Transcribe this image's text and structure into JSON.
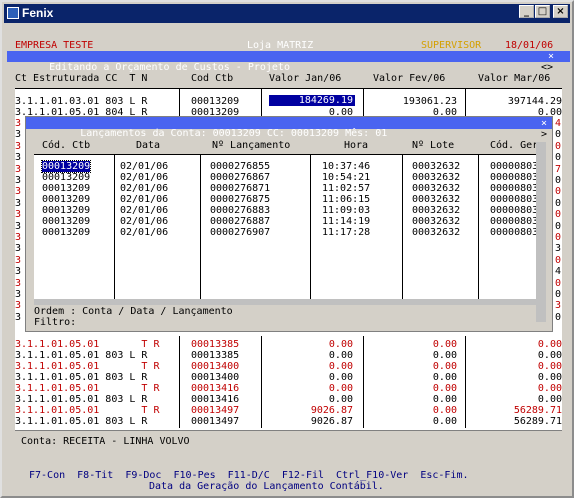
{
  "window": {
    "title": "Fenix"
  },
  "header": {
    "company": "EMPRESA TESTE",
    "store": "Loja MATRIZ",
    "role": "SUPERVISOR",
    "date": "18/01/06",
    "screen_title": " Editando a Orçamento de Custos - Projeto",
    "close_glyph": "×",
    "scroll_glyph": "<>"
  },
  "main": {
    "headers": {
      "ct": "Ct Estruturada CC  T N",
      "cod": "Cod Ctb",
      "jan": "Valor Jan/06",
      "fev": "Valor Fev/06",
      "mar": "Valor Mar/06"
    },
    "top_rows": [
      {
        "ct": "3.1.1.01.03.01 803 L R",
        "cod": "00013209",
        "jan": "184269.19",
        "fev": "193061.23",
        "mar": "397144.29"
      },
      {
        "ct": "3.1.1.01.05.01 804 L R",
        "cod": "00013209",
        "jan": "0.00",
        "fev": "0.00",
        "mar": "0.00"
      }
    ],
    "left_stub": [
      "3",
      "3",
      "3",
      "3",
      "3",
      "3",
      "3",
      "3",
      "3",
      "3",
      "3",
      "3",
      "3",
      "3",
      "3",
      "3",
      "3",
      "3"
    ],
    "right_stub": [
      "4",
      "0",
      "0",
      "0",
      "7",
      "0",
      "0",
      "0",
      "0",
      "0",
      "0",
      "3",
      "0",
      "4",
      "0",
      "0",
      "3",
      "0"
    ],
    "bottom_rows": [
      {
        "ct": "3.1.1.01.05.01       T R",
        "cod": "00013385",
        "jan": "0.00",
        "fev": "0.00",
        "mar": "0.00",
        "red": true
      },
      {
        "ct": "3.1.1.01.05.01 803 L R",
        "cod": "00013385",
        "jan": "0.00",
        "fev": "0.00",
        "mar": "0.00",
        "red": false
      },
      {
        "ct": "3.1.1.01.05.01       T R",
        "cod": "00013400",
        "jan": "0.00",
        "fev": "0.00",
        "mar": "0.00",
        "red": true
      },
      {
        "ct": "3.1.1.01.05.01 803 L R",
        "cod": "00013400",
        "jan": "0.00",
        "fev": "0.00",
        "mar": "0.00",
        "red": false
      },
      {
        "ct": "3.1.1.01.05.01       T R",
        "cod": "00013416",
        "jan": "0.00",
        "fev": "0.00",
        "mar": "0.00",
        "red": true
      },
      {
        "ct": "3.1.1.01.05.01 803 L R",
        "cod": "00013416",
        "jan": "0.00",
        "fev": "0.00",
        "mar": "0.00",
        "red": false
      },
      {
        "ct": "3.1.1.01.05.01       T R",
        "cod": "00013497",
        "jan": "9026.87",
        "fev": "0.00",
        "mar": "56289.71",
        "red": true
      },
      {
        "ct": "3.1.1.01.05.01 803 L R",
        "cod": "00013497",
        "jan": "9026.87",
        "fev": "0.00",
        "mar": "56289.71",
        "red": false
      }
    ],
    "account_line": "Conta: RECEITA - LINHA VOLVO"
  },
  "popup": {
    "title": " Lançamentos da Conta: 00013209 CC: 00013209 Mês: 01",
    "close_glyph": "×",
    "scroll_glyph": ">",
    "headers": {
      "cod": "Cód. Ctb",
      "data": "Data",
      "lanc": "Nº Lançamento",
      "hora": "Hora",
      "lote": "Nº Lote",
      "ger": "Cód. Ger"
    },
    "rows": [
      {
        "cod": "00013209",
        "data": "02/01/06",
        "lanc": "0000276855",
        "hora": "10:37:46",
        "lote": "00032632",
        "ger": "00000803"
      },
      {
        "cod": "00013209",
        "data": "02/01/06",
        "lanc": "0000276867",
        "hora": "10:54:21",
        "lote": "00032632",
        "ger": "00000803"
      },
      {
        "cod": "00013209",
        "data": "02/01/06",
        "lanc": "0000276871",
        "hora": "11:02:57",
        "lote": "00032632",
        "ger": "00000803"
      },
      {
        "cod": "00013209",
        "data": "02/01/06",
        "lanc": "0000276875",
        "hora": "11:06:15",
        "lote": "00032632",
        "ger": "00000803"
      },
      {
        "cod": "00013209",
        "data": "02/01/06",
        "lanc": "0000276883",
        "hora": "11:09:03",
        "lote": "00032632",
        "ger": "00000803"
      },
      {
        "cod": "00013209",
        "data": "02/01/06",
        "lanc": "0000276887",
        "hora": "11:14:19",
        "lote": "00032632",
        "ger": "00000803"
      },
      {
        "cod": "00013209",
        "data": "02/01/06",
        "lanc": "0000276907",
        "hora": "11:17:28",
        "lote": "00032632",
        "ger": "00000803"
      }
    ],
    "order_line": "Ordem : Conta / Data / Lançamento",
    "filter_label": "Filtro:"
  },
  "footer": {
    "keys": "F7-Con  F8-Tit  F9-Doc  F10-Pes  F11-D/C  F12-Fil  Ctrl_F10-Ver  Esc-Fim.",
    "status": "Data da Geração do Lançamento Contábil."
  },
  "colors": {
    "title_bar": "#0a246a",
    "accent_bar": "#4a64f0",
    "red_text": "#c00000",
    "supervisor": "#d4a000",
    "footer_text": "#000080"
  }
}
